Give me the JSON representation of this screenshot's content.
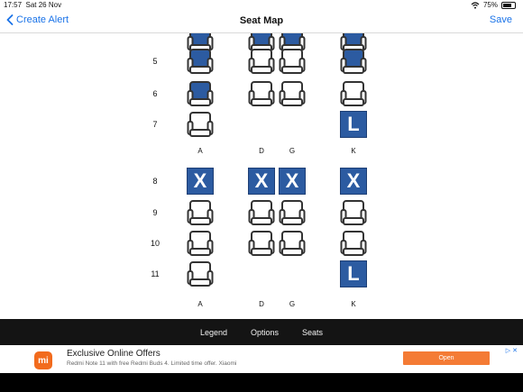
{
  "status_bar": {
    "time": "17:57",
    "date": "Sat 26 Nov",
    "wifi_icon": "wifi-icon",
    "battery_text": "75%",
    "battery_level": 0.75
  },
  "nav": {
    "back_label": "Create Alert",
    "title": "Seat Map",
    "save_label": "Save"
  },
  "colors": {
    "accent": "#1a73e8",
    "seat_taken": "#2c5ba1",
    "seat_outline": "#333333",
    "ad_button": "#f47b35",
    "toolbar_bg": "#141414"
  },
  "legend": {
    "occupied": "filled-blue-seat",
    "available": "outline-seat",
    "blocked": "X",
    "lavatory": "L"
  },
  "seatmap": {
    "columns": [
      "A",
      "D",
      "G",
      "K"
    ],
    "section1": {
      "rows": [
        {
          "label": "",
          "seats": {
            "A": "occupied",
            "D": "occupied",
            "G": "occupied",
            "K": "occupied"
          }
        },
        {
          "label": "5",
          "seats": {
            "A": "occupied",
            "D": "available",
            "G": "available",
            "K": "occupied"
          }
        },
        {
          "label": "6",
          "seats": {
            "A": "occupied",
            "D": "available",
            "G": "available",
            "K": "available"
          }
        },
        {
          "label": "7",
          "seats": {
            "A": "available",
            "D": "",
            "G": "",
            "K": "L"
          }
        }
      ]
    },
    "section2": {
      "rows": [
        {
          "label": "8",
          "seats": {
            "A": "X",
            "D": "X",
            "G": "X",
            "K": "X"
          }
        },
        {
          "label": "9",
          "seats": {
            "A": "available",
            "D": "available",
            "G": "available",
            "K": "available"
          }
        },
        {
          "label": "10",
          "seats": {
            "A": "available",
            "D": "available",
            "G": "available",
            "K": "available"
          }
        },
        {
          "label": "11",
          "seats": {
            "A": "available",
            "D": "",
            "G": "",
            "K": "L"
          }
        }
      ]
    }
  },
  "toolbar": {
    "legend": "Legend",
    "options": "Options",
    "seats": "Seats"
  },
  "ad": {
    "logo_text": "mi",
    "title": "Exclusive Online Offers",
    "subtitle": "Redmi Note 11 with free Redmi Buds 4. Limited time offer. Xiaomi",
    "button": "Open",
    "choices_icon": "ad-choices-icon"
  }
}
